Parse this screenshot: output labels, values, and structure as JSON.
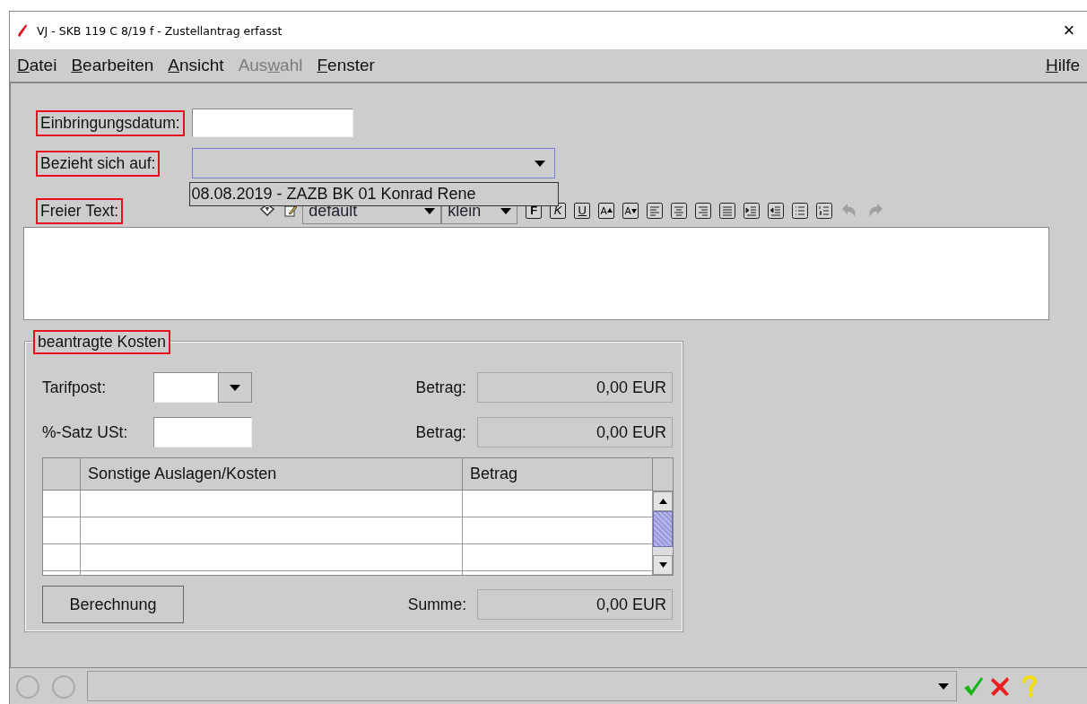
{
  "window": {
    "title": "VJ - SKB 119 C 8/19 f - Zustellantrag erfasst",
    "close": "×"
  },
  "menu": [
    {
      "key": "D",
      "post": "atei",
      "disabled": false
    },
    {
      "key": "B",
      "post": "earbeiten",
      "disabled": false
    },
    {
      "key": "A",
      "post": "nsicht",
      "disabled": false
    },
    {
      "pre": "Aus",
      "key": "w",
      "post": "ahl",
      "disabled": true
    },
    {
      "key": "F",
      "post": "enster",
      "disabled": false
    }
  ],
  "help_menu": {
    "key": "H",
    "post": "ilfe",
    "disabled": false
  },
  "form": {
    "einbringungsdatum": {
      "label": "Einbringungsdatum:",
      "highlighted": true
    },
    "bezieht": {
      "label": "Bezieht sich auf:",
      "highlighted": true,
      "expanded": true,
      "options": [
        "08.08.2019 - ZAZB BK 01 Konrad Rene"
      ]
    },
    "freier_text": {
      "label": "Freier Text:",
      "highlighted": true,
      "font": "default",
      "size": "klein",
      "tools": [
        {
          "kind": "stamp"
        },
        {
          "kind": "note"
        },
        {
          "kind": "font"
        },
        {
          "kind": "size"
        },
        {
          "kind": "bold",
          "label": "F"
        },
        {
          "kind": "italic",
          "label": "K"
        },
        {
          "kind": "underline",
          "label": "U"
        },
        {
          "kind": "grow",
          "label": "A"
        },
        {
          "kind": "shrink",
          "label": "A"
        },
        {
          "kind": "align-left"
        },
        {
          "kind": "align-center"
        },
        {
          "kind": "align-right"
        },
        {
          "kind": "justify"
        },
        {
          "kind": "indent"
        },
        {
          "kind": "outdent"
        },
        {
          "kind": "bullets"
        },
        {
          "kind": "numbers"
        },
        {
          "kind": "undo",
          "disabled": true
        },
        {
          "kind": "redo",
          "disabled": true
        }
      ]
    }
  },
  "kosten": {
    "title": "beantragte Kosten",
    "highlighted": true,
    "tarifpost": {
      "label": "Tarifpost:"
    },
    "ust": {
      "label": "%-Satz USt:"
    },
    "betrag1": {
      "label": "Betrag:",
      "value": "0,00 EUR"
    },
    "betrag2": {
      "label": "Betrag:",
      "value": "0,00 EUR"
    },
    "table": {
      "columns": [
        "Sonstige Auslagen/Kosten",
        "Betrag"
      ]
    },
    "button": "Berechnung",
    "summe": {
      "label": "Summe:",
      "value": "0,00 EUR"
    }
  }
}
